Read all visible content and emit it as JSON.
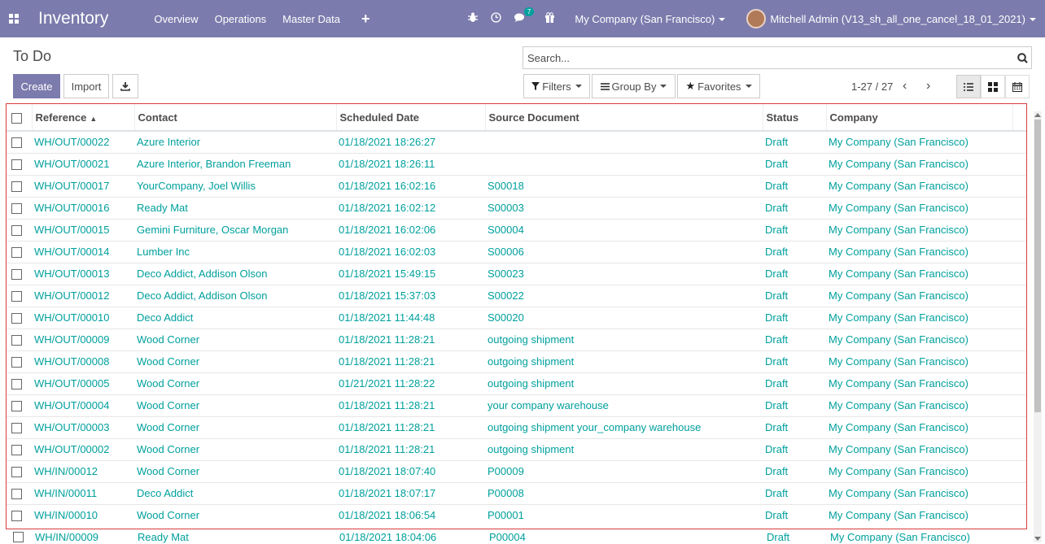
{
  "navbar": {
    "app_name": "Inventory",
    "menu": [
      "Overview",
      "Operations",
      "Master Data"
    ],
    "messages_badge": "7",
    "company": "My Company (San Francisco)",
    "user": "Mitchell Admin (V13_sh_all_one_cancel_18_01_2021)",
    "bg_color": "#7c7bad"
  },
  "control_panel": {
    "breadcrumb": "To Do",
    "search_placeholder": "Search...",
    "buttons": {
      "create": "Create",
      "import": "Import"
    },
    "filters": {
      "filters": "Filters",
      "group_by": "Group By",
      "favorites": "Favorites"
    },
    "pager": "1-27 / 27"
  },
  "table": {
    "columns": [
      "Reference",
      "Contact",
      "Scheduled Date",
      "Source Document",
      "Status",
      "Company"
    ],
    "rows": [
      [
        "WH/OUT/00022",
        "Azure Interior",
        "01/18/2021 18:26:27",
        "",
        "Draft",
        "My Company (San Francisco)"
      ],
      [
        "WH/OUT/00021",
        "Azure Interior, Brandon Freeman",
        "01/18/2021 18:26:11",
        "",
        "Draft",
        "My Company (San Francisco)"
      ],
      [
        "WH/OUT/00017",
        "YourCompany, Joel Willis",
        "01/18/2021 16:02:16",
        "S00018",
        "Draft",
        "My Company (San Francisco)"
      ],
      [
        "WH/OUT/00016",
        "Ready Mat",
        "01/18/2021 16:02:12",
        "S00003",
        "Draft",
        "My Company (San Francisco)"
      ],
      [
        "WH/OUT/00015",
        "Gemini Furniture, Oscar Morgan",
        "01/18/2021 16:02:06",
        "S00004",
        "Draft",
        "My Company (San Francisco)"
      ],
      [
        "WH/OUT/00014",
        "Lumber Inc",
        "01/18/2021 16:02:03",
        "S00006",
        "Draft",
        "My Company (San Francisco)"
      ],
      [
        "WH/OUT/00013",
        "Deco Addict, Addison Olson",
        "01/18/2021 15:49:15",
        "S00023",
        "Draft",
        "My Company (San Francisco)"
      ],
      [
        "WH/OUT/00012",
        "Deco Addict, Addison Olson",
        "01/18/2021 15:37:03",
        "S00022",
        "Draft",
        "My Company (San Francisco)"
      ],
      [
        "WH/OUT/00010",
        "Deco Addict",
        "01/18/2021 11:44:48",
        "S00020",
        "Draft",
        "My Company (San Francisco)"
      ],
      [
        "WH/OUT/00009",
        "Wood Corner",
        "01/18/2021 11:28:21",
        "outgoing shipment",
        "Draft",
        "My Company (San Francisco)"
      ],
      [
        "WH/OUT/00008",
        "Wood Corner",
        "01/18/2021 11:28:21",
        "outgoing shipment",
        "Draft",
        "My Company (San Francisco)"
      ],
      [
        "WH/OUT/00005",
        "Wood Corner",
        "01/21/2021 11:28:22",
        "outgoing shipment",
        "Draft",
        "My Company (San Francisco)"
      ],
      [
        "WH/OUT/00004",
        "Wood Corner",
        "01/18/2021 11:28:21",
        "your company warehouse",
        "Draft",
        "My Company (San Francisco)"
      ],
      [
        "WH/OUT/00003",
        "Wood Corner",
        "01/18/2021 11:28:21",
        "outgoing shipment your_company warehouse",
        "Draft",
        "My Company (San Francisco)"
      ],
      [
        "WH/OUT/00002",
        "Wood Corner",
        "01/18/2021 11:28:21",
        "outgoing shipment",
        "Draft",
        "My Company (San Francisco)"
      ],
      [
        "WH/IN/00012",
        "Wood Corner",
        "01/18/2021 18:07:40",
        "P00009",
        "Draft",
        "My Company (San Francisco)"
      ],
      [
        "WH/IN/00011",
        "Deco Addict",
        "01/18/2021 18:07:17",
        "P00008",
        "Draft",
        "My Company (San Francisco)"
      ],
      [
        "WH/IN/00010",
        "Wood Corner",
        "01/18/2021 18:06:54",
        "P00001",
        "Draft",
        "My Company (San Francisco)"
      ]
    ],
    "overflow_row": [
      "WH/IN/00009",
      "Ready Mat",
      "01/18/2021 18:04:06",
      "P00004",
      "Draft",
      "My Company (San Francisco)"
    ],
    "link_color": "#00a09d"
  }
}
